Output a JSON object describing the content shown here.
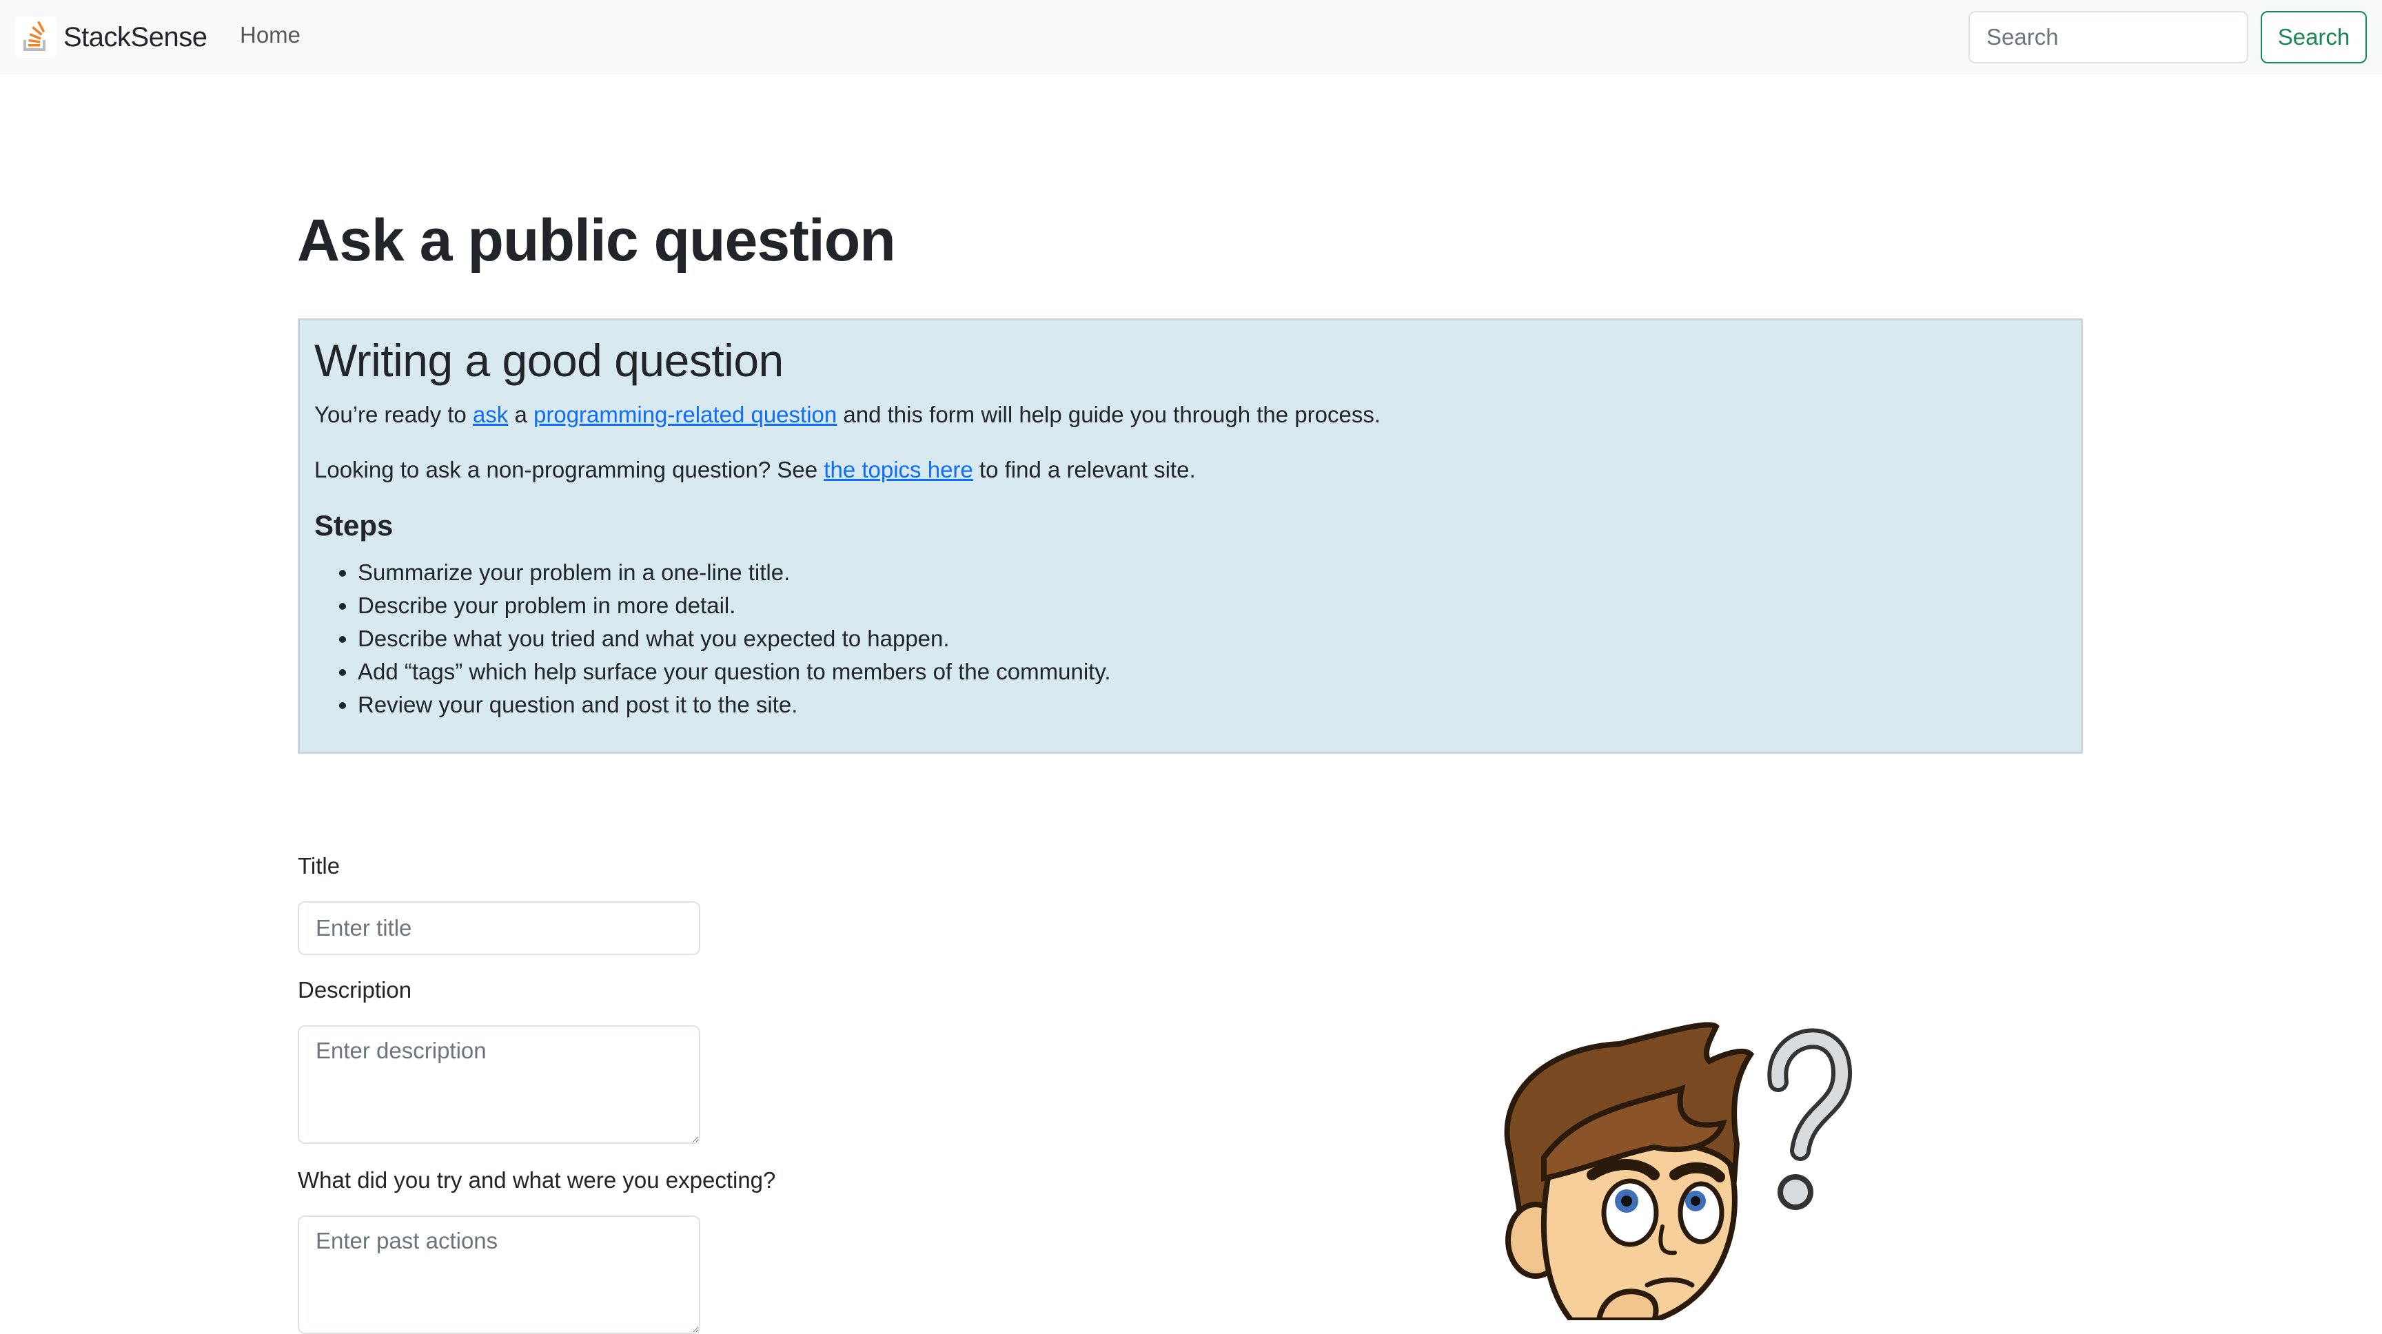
{
  "navbar": {
    "brand": "StackSense",
    "home_link": "Home",
    "search_placeholder": "Search",
    "search_button": "Search"
  },
  "page": {
    "title": "Ask a public question"
  },
  "guide": {
    "title": "Writing a good question",
    "p1_before": "You’re ready to ",
    "p1_link1": "ask",
    "p1_middle": " a ",
    "p1_link2": "programming-related question",
    "p1_after": " and this form will help guide you through the process.",
    "p2_before": "Looking to ask a non-programming question? See ",
    "p2_link": "the topics here",
    "p2_after": " to find a relevant site.",
    "steps_title": "Steps",
    "steps": [
      "Summarize your problem in a one-line title.",
      "Describe your problem in more detail.",
      "Describe what you tried and what you expected to happen.",
      "Add “tags” which help surface your question to members of the community.",
      "Review your question and post it to the site."
    ]
  },
  "form": {
    "title_label": "Title",
    "title_placeholder": "Enter title",
    "description_label": "Description",
    "description_placeholder": "Enter description",
    "past_label": "What did you try and what were you expecting?",
    "past_placeholder": "Enter past actions"
  },
  "illustration": {
    "icon": "thinking-man-with-question-mark"
  },
  "colors": {
    "navbar_bg": "#f8f9fa",
    "info_bg": "#d9e9f0",
    "link": "#0d6efd",
    "success": "#198754"
  }
}
